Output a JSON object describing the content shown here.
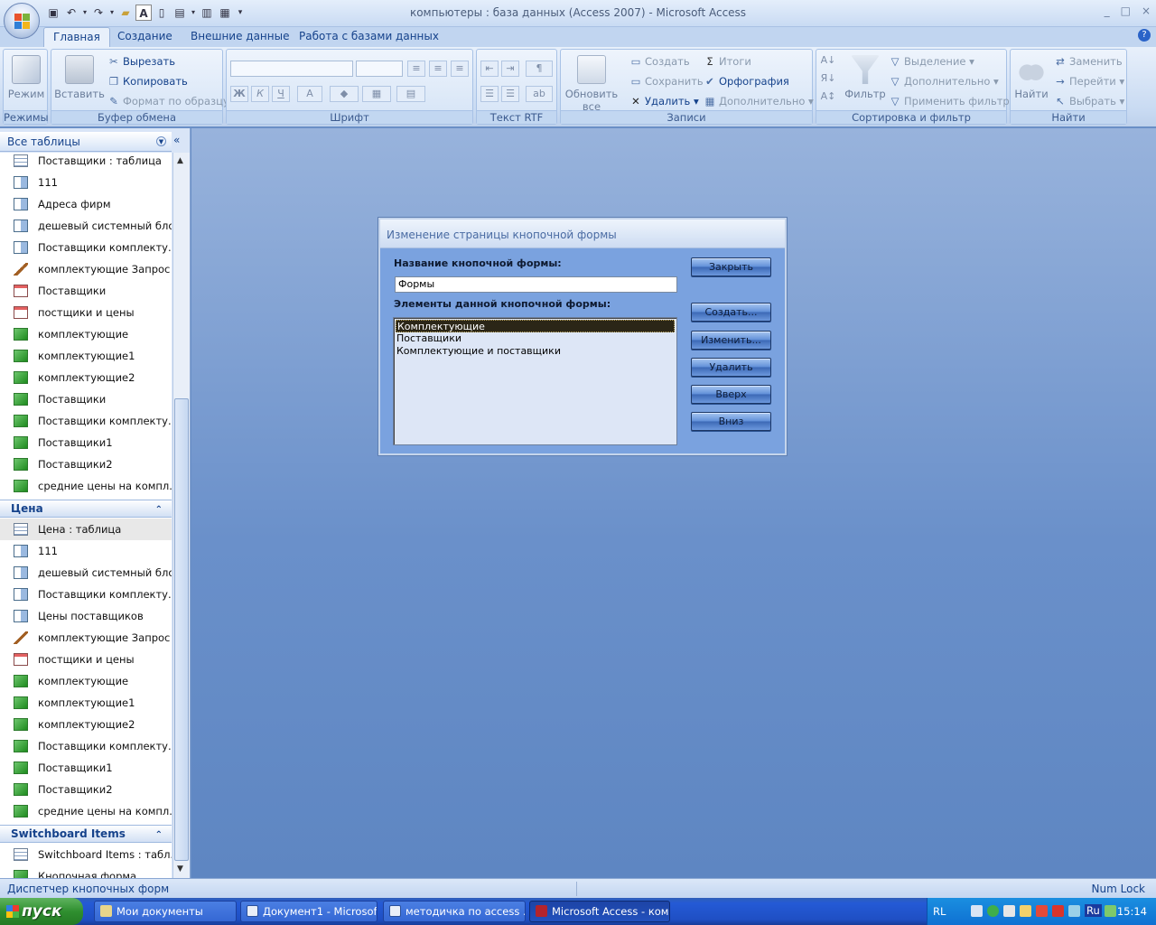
{
  "window": {
    "title": "компьютеры : база данных (Access 2007) - Microsoft Access",
    "min": "_",
    "max": "□",
    "close": "×"
  },
  "tabs": [
    "Главная",
    "Создание",
    "Внешние данные",
    "Работа с базами данных"
  ],
  "ribbon": {
    "modes": {
      "label": "Режим",
      "group": "Режимы"
    },
    "clipboard": {
      "paste": "Вставить",
      "cut": "Вырезать",
      "copy": "Копировать",
      "format": "Формат по образцу",
      "group": "Буфер обмена"
    },
    "font": {
      "group": "Шрифт",
      "bold": "Ж",
      "italic": "К",
      "underline": "Ч",
      "color": "A"
    },
    "rtf": {
      "group": "Текст RTF"
    },
    "records": {
      "refresh": "Обновить все",
      "new": "Создать",
      "save": "Сохранить",
      "delete": "Удалить",
      "totals": "Итоги",
      "spelling": "Орфография",
      "more": "Дополнительно",
      "group": "Записи"
    },
    "sort": {
      "filter": "Фильтр",
      "selection": "Выделение",
      "advanced": "Дополнительно",
      "apply": "Применить фильтр",
      "group": "Сортировка и фильтр"
    },
    "find": {
      "find": "Найти",
      "replace": "Заменить",
      "goto": "Перейти",
      "select": "Выбрать",
      "group": "Найти"
    }
  },
  "nav": {
    "header": "Все таблицы",
    "items_top": [
      {
        "label": "Поставщики : таблица",
        "icon": "table-icon"
      },
      {
        "label": "111",
        "icon": "query-icon"
      },
      {
        "label": "Адреса фирм",
        "icon": "query-icon"
      },
      {
        "label": "дешевый системный блок",
        "icon": "query-icon"
      },
      {
        "label": "Поставщики комплекту...",
        "icon": "query-icon"
      },
      {
        "label": "комплектующие Запрос",
        "icon": "action-query-icon"
      },
      {
        "label": "Поставщики",
        "icon": "form-icon"
      },
      {
        "label": "постщики и цены",
        "icon": "form-icon"
      },
      {
        "label": "комплектующие",
        "icon": "report-icon"
      },
      {
        "label": "комплектующие1",
        "icon": "report-icon"
      },
      {
        "label": "комплектующие2",
        "icon": "report-icon"
      },
      {
        "label": "Поставщики",
        "icon": "report-icon"
      },
      {
        "label": "Поставщики комплекту...",
        "icon": "report-icon"
      },
      {
        "label": "Поставщики1",
        "icon": "report-icon"
      },
      {
        "label": "Поставщики2",
        "icon": "report-icon"
      },
      {
        "label": "средние цены на компл...",
        "icon": "report-icon"
      }
    ],
    "section_price": "Цена",
    "items_price": [
      {
        "label": "Цена : таблица",
        "icon": "table-icon"
      },
      {
        "label": "111",
        "icon": "query-icon"
      },
      {
        "label": "дешевый системный блок",
        "icon": "query-icon"
      },
      {
        "label": "Поставщики комплекту...",
        "icon": "query-icon"
      },
      {
        "label": "Цены поставщиков",
        "icon": "query-icon"
      },
      {
        "label": "комплектующие Запрос",
        "icon": "action-query-icon"
      },
      {
        "label": "постщики и цены",
        "icon": "form-icon"
      },
      {
        "label": "комплектующие",
        "icon": "report-icon"
      },
      {
        "label": "комплектующие1",
        "icon": "report-icon"
      },
      {
        "label": "комплектующие2",
        "icon": "report-icon"
      },
      {
        "label": "Поставщики комплекту...",
        "icon": "report-icon"
      },
      {
        "label": "Поставщики1",
        "icon": "report-icon"
      },
      {
        "label": "Поставщики2",
        "icon": "report-icon"
      },
      {
        "label": "средние цены на компл...",
        "icon": "report-icon"
      }
    ],
    "section_switch": "Switchboard Items",
    "items_switch": [
      {
        "label": "Switchboard Items : табл...",
        "icon": "table-icon"
      },
      {
        "label": "Кнопочная форма",
        "icon": "report-icon"
      }
    ]
  },
  "dialog": {
    "title": "Изменение страницы кнопочной формы",
    "name_label": "Название кнопочной формы:",
    "name_value": "Формы",
    "items_label": "Элементы данной кнопочной формы:",
    "items": [
      "Комплектующие",
      "Поставщики",
      "Комплектующие и поставщики"
    ],
    "buttons": {
      "close": "Закрыть",
      "create": "Создать...",
      "edit": "Изменить...",
      "delete": "Удалить",
      "up": "Вверх",
      "down": "Вниз"
    }
  },
  "status": {
    "left": "Диспетчер кнопочных форм",
    "right": "Num Lock"
  },
  "taskbar": {
    "start": "пуск",
    "tasks": [
      "Мои документы",
      "Документ1 - Microsof...",
      "методичка по access ...",
      "Microsoft Access - ком..."
    ],
    "lang": "RL",
    "kbd": "Ru",
    "clock": "15:14"
  }
}
